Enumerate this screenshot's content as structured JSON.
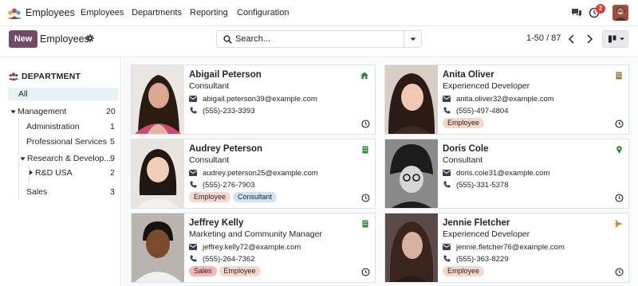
{
  "topbar": {
    "app_name": "Employees",
    "menu": [
      "Employees",
      "Departments",
      "Reporting",
      "Configuration"
    ],
    "activity_badge": "2"
  },
  "control": {
    "new_label": "New",
    "title": "Employees",
    "search_placeholder": "Search...",
    "pager": "1-50 / 87"
  },
  "sidebar": {
    "heading": "DEPARTMENT",
    "all_label": "All",
    "items": [
      {
        "label": "Management",
        "count": "20"
      },
      {
        "label": "Administration",
        "count": "1"
      },
      {
        "label": "Professional Services",
        "count": "5"
      },
      {
        "label": "Research & Develop...",
        "count": "9"
      },
      {
        "label": "R&D USA",
        "count": "2"
      },
      {
        "label": "Sales",
        "count": "3"
      }
    ]
  },
  "employees": [
    {
      "name": "Abigail Peterson",
      "job": "Consultant",
      "email": "abigail.peterson39@example.com",
      "phone": "(555)-233-3393",
      "tags": [],
      "status_icon": "home-icon"
    },
    {
      "name": "Anita Oliver",
      "job": "Experienced Developer",
      "email": "anita.oliver32@example.com",
      "phone": "(555)-497-4804",
      "tags": [
        "Employee"
      ],
      "status_icon": "office-icon"
    },
    {
      "name": "Audrey Peterson",
      "job": "Consultant",
      "email": "audrey.peterson25@example.com",
      "phone": "(555)-276-7903",
      "tags": [
        "Employee",
        "Consultant"
      ],
      "status_icon": "building-icon"
    },
    {
      "name": "Doris Cole",
      "job": "Consultant",
      "email": "doris.cole31@example.com",
      "phone": "(555)-331-5378",
      "tags": [],
      "status_icon": "location-pin-icon"
    },
    {
      "name": "Jeffrey Kelly",
      "job": "Marketing and Community Manager",
      "email": "jeffrey.kelly72@example.com",
      "phone": "(555)-264-7362",
      "tags": [
        "Sales",
        "Employee"
      ],
      "status_icon": "building-icon"
    },
    {
      "name": "Jennie Fletcher",
      "job": "Experienced Developer",
      "email": "jennie.fletcher76@example.com",
      "phone": "(555)-363-8229",
      "tags": [
        "Employee"
      ],
      "status_icon": "airplane-icon"
    }
  ],
  "tag_colors": {
    "Employee": "#f7d6cb",
    "Consultant": "#cfe3f7",
    "Sales": "#f8b5b5"
  },
  "colors": {
    "brand": "#714b67",
    "selected_bg": "#e6f2f3",
    "badge": "#e0382b"
  }
}
